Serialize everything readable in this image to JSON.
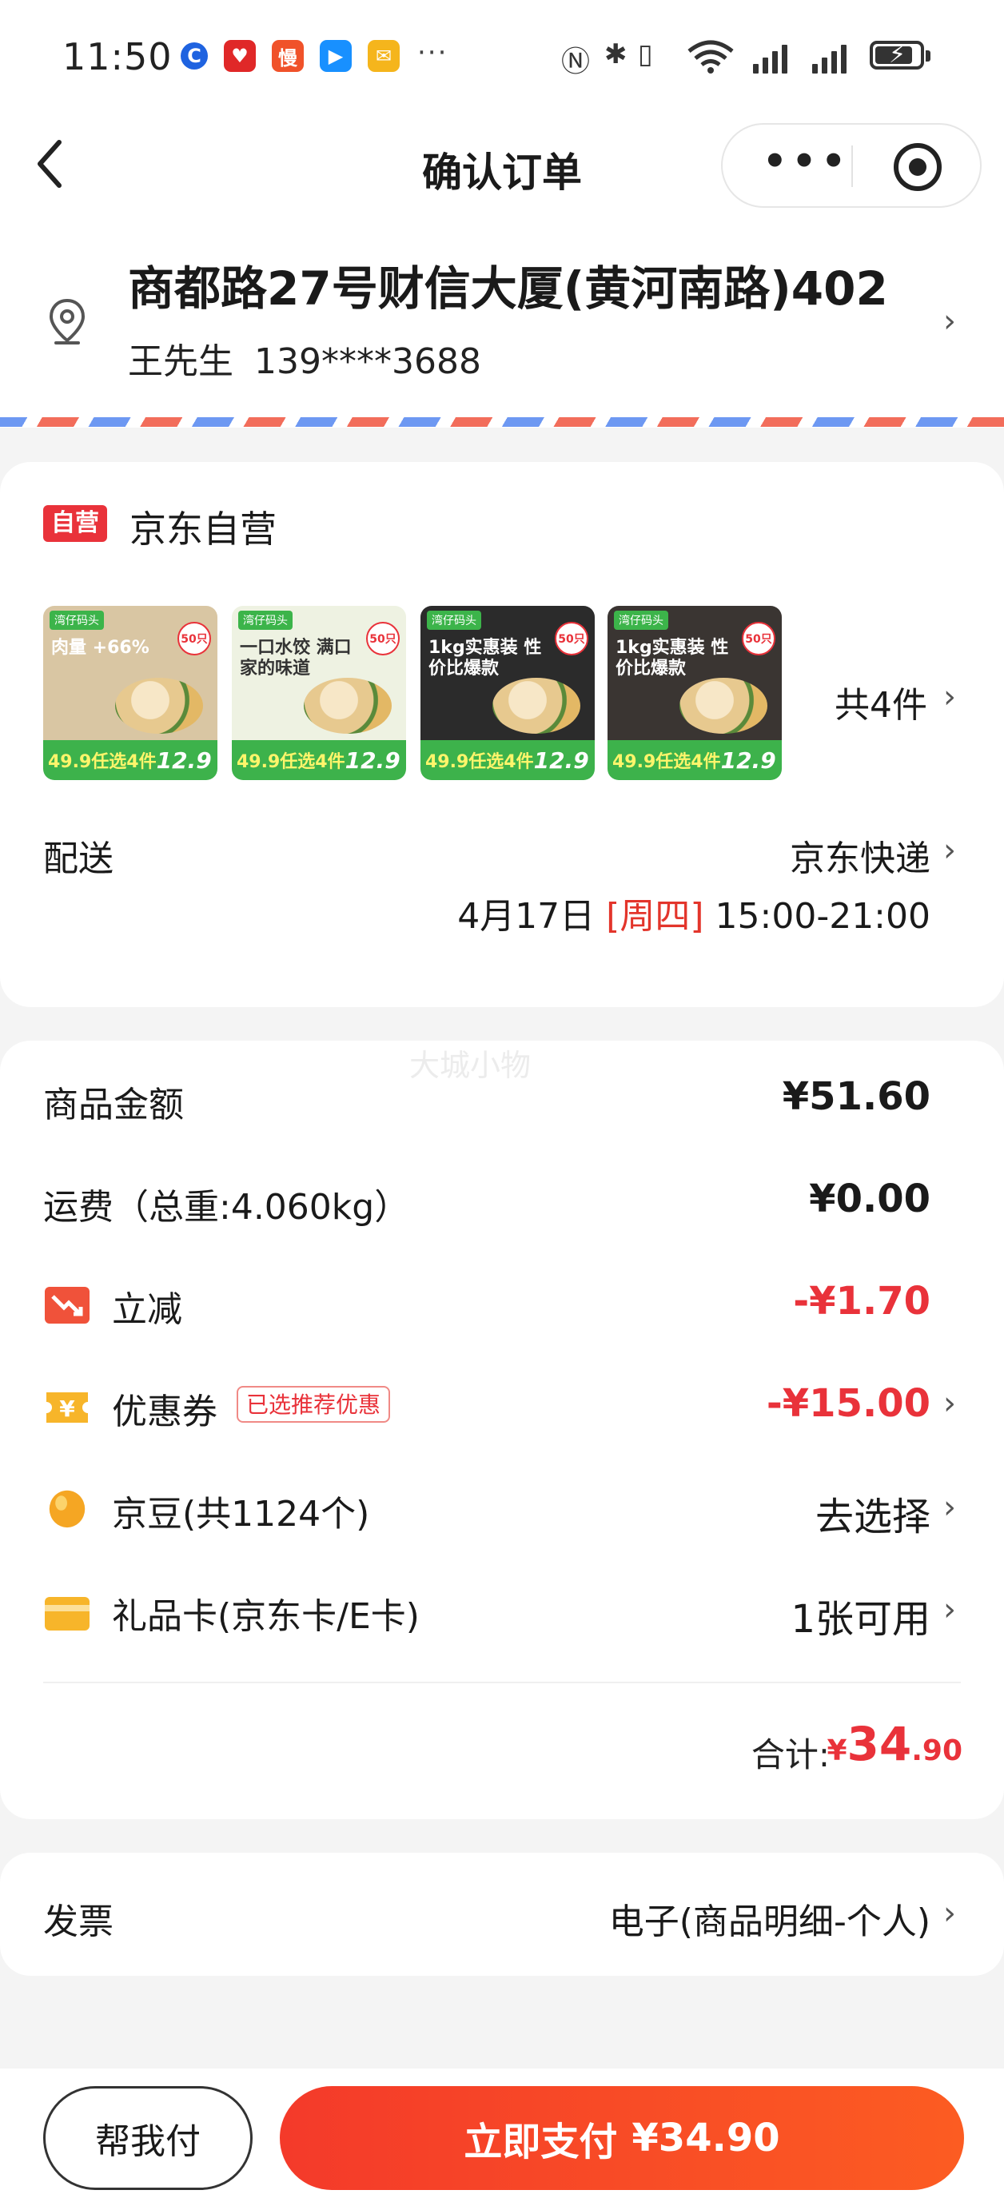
{
  "status_bar": {
    "time": "11:50",
    "more": "···",
    "network_icons": [
      "nfc-icon",
      "bluetooth-icon",
      "vibrate-icon",
      "wifi-icon",
      "signal-icon",
      "signal-icon",
      "battery-charging-icon"
    ]
  },
  "nav": {
    "title": "确认订单",
    "more_label": "•••"
  },
  "address": {
    "line": "商都路27号财信大厦(黄河南路)402",
    "name": "王先生",
    "phone": "139****3688"
  },
  "shop": {
    "badge": "自营",
    "name": "京东自营",
    "products": [
      {
        "brand": "湾仔码头",
        "headline": "肉量 +66%",
        "seal": "50只",
        "promo": "49.9任选4件",
        "price": "12.9",
        "top_color": "#d9c6a3",
        "dark": false
      },
      {
        "brand": "湾仔码头",
        "headline": "一口水饺 满口家的味道",
        "seal": "50只",
        "promo": "49.9任选4件",
        "price": "12.9",
        "top_color": "#eef2e2",
        "dark": true
      },
      {
        "brand": "湾仔码头",
        "headline": "1kg实惠装 性价比爆款",
        "seal": "50只",
        "promo": "49.9任选4件",
        "price": "12.9",
        "top_color": "#2b2b2b",
        "dark": false
      },
      {
        "brand": "湾仔码头",
        "headline": "1kg实惠装 性价比爆款",
        "seal": "50只",
        "promo": "49.9任选4件",
        "price": "12.9",
        "top_color": "#3a3532",
        "dark": false
      }
    ],
    "count_text": "共4件"
  },
  "delivery": {
    "label": "配送",
    "method": "京东快递",
    "date": "4月17日",
    "weekday": "[周四]",
    "time_range": "15:00-21:00"
  },
  "watermark": "大城小物",
  "price_rows": {
    "goods_label": "商品金额",
    "goods_value": "¥51.60",
    "freight_label": "运费（总重:4.060kg）",
    "freight_value": "¥0.00",
    "discount_label": "立减",
    "discount_value": "-¥1.70",
    "coupon_label": "优惠券",
    "coupon_badge": "已选推荐优惠",
    "coupon_value": "-¥15.00",
    "beans_label": "京豆(共1124个)",
    "beans_value": "去选择",
    "giftcard_label": "礼品卡(京东卡/E卡)",
    "giftcard_value": "1张可用"
  },
  "total": {
    "label": "合计:",
    "currency": "¥",
    "integer": "34",
    "decimal": ".90"
  },
  "invoice": {
    "label": "发票",
    "value": "电子(商品明细-个人)"
  },
  "bottom": {
    "help_pay": "帮我付",
    "pay_label": "立即支付",
    "pay_amount": "¥34.90"
  },
  "colors": {
    "accent_red": "#e9323a",
    "pay_gradient_start": "#f43a2a",
    "pay_gradient_end": "#fc5c22"
  }
}
